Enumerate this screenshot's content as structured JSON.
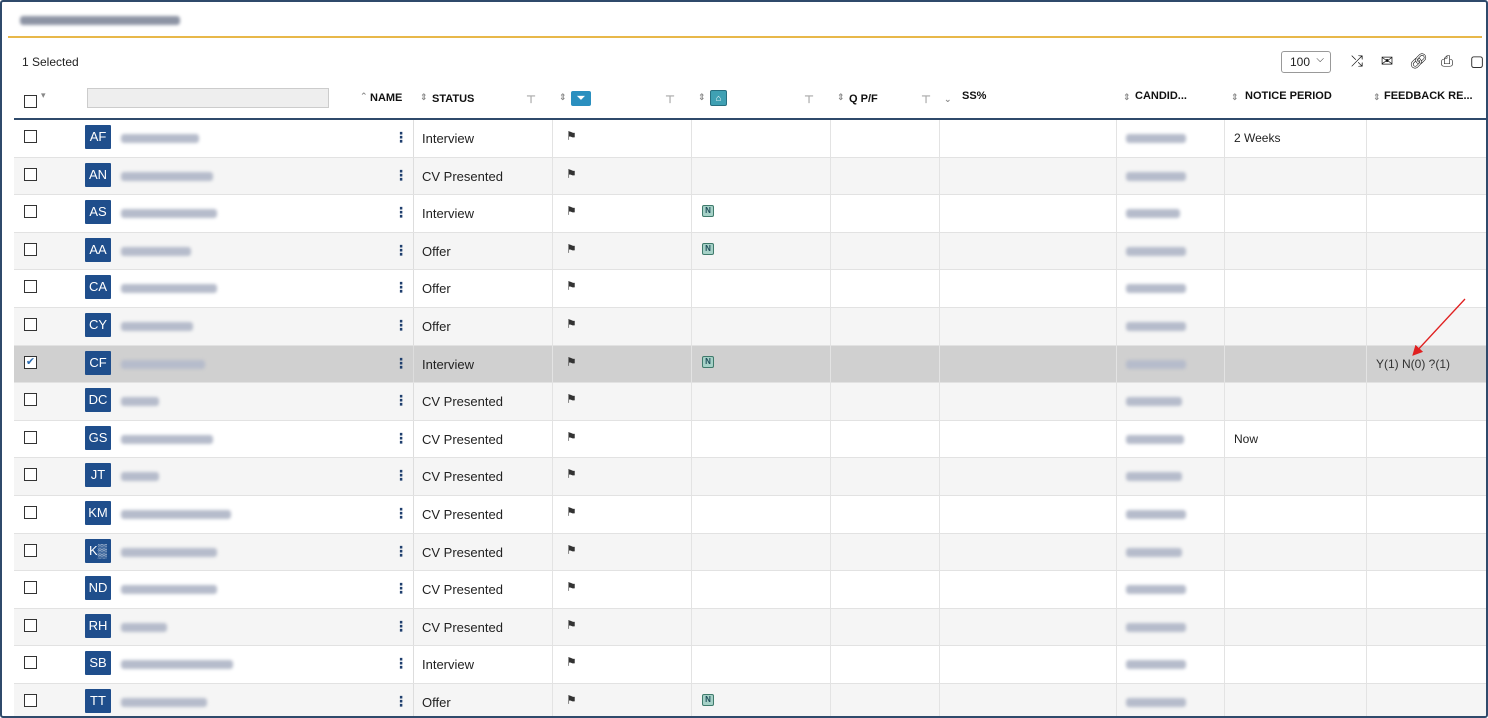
{
  "toolbar": {
    "selected_label": "1 Selected",
    "page_size": "100",
    "icons": [
      "shuffle-icon",
      "envelope-icon",
      "link-icon",
      "print-icon",
      "note-icon"
    ]
  },
  "columns": {
    "name": "NAME",
    "status": "STATUS",
    "qpf": "Q P/F",
    "ss": "SS%",
    "candid": "CANDID...",
    "notice": "NOTICE PERIOD",
    "feedback": "FEEDBACK RE..."
  },
  "rows": [
    {
      "initials": "AF",
      "status": "Interview",
      "n_badge": false,
      "notice": "2 Weeks",
      "feedback": "",
      "checked": false
    },
    {
      "initials": "AN",
      "status": "CV Presented",
      "n_badge": false,
      "notice": "",
      "feedback": "",
      "checked": false
    },
    {
      "initials": "AS",
      "status": "Interview",
      "n_badge": true,
      "notice": "",
      "feedback": "",
      "checked": false
    },
    {
      "initials": "AA",
      "status": "Offer",
      "n_badge": true,
      "notice": "",
      "feedback": "",
      "checked": false
    },
    {
      "initials": "CA",
      "status": "Offer",
      "n_badge": false,
      "notice": "",
      "feedback": "",
      "checked": false
    },
    {
      "initials": "CY",
      "status": "Offer",
      "n_badge": false,
      "notice": "",
      "feedback": "",
      "checked": false
    },
    {
      "initials": "CF",
      "status": "Interview",
      "n_badge": true,
      "notice": "",
      "feedback": "Y(1) N(0) ?(1)",
      "checked": true
    },
    {
      "initials": "DC",
      "status": "CV Presented",
      "n_badge": false,
      "notice": "",
      "feedback": "",
      "checked": false
    },
    {
      "initials": "GS",
      "status": "CV Presented",
      "n_badge": false,
      "notice": "Now",
      "feedback": "",
      "checked": false
    },
    {
      "initials": "JT",
      "status": "CV Presented",
      "n_badge": false,
      "notice": "",
      "feedback": "",
      "checked": false
    },
    {
      "initials": "KM",
      "status": "CV Presented",
      "n_badge": false,
      "notice": "",
      "feedback": "",
      "checked": false
    },
    {
      "initials": "K▒",
      "status": "CV Presented",
      "n_badge": false,
      "notice": "",
      "feedback": "",
      "checked": false
    },
    {
      "initials": "ND",
      "status": "CV Presented",
      "n_badge": false,
      "notice": "",
      "feedback": "",
      "checked": false
    },
    {
      "initials": "RH",
      "status": "CV Presented",
      "n_badge": false,
      "notice": "",
      "feedback": "",
      "checked": false
    },
    {
      "initials": "SB",
      "status": "Interview",
      "n_badge": false,
      "notice": "",
      "feedback": "",
      "checked": false
    },
    {
      "initials": "TT",
      "status": "Offer",
      "n_badge": true,
      "notice": "",
      "feedback": "",
      "checked": false
    }
  ],
  "colors": {
    "avatar": "#1f4e8c",
    "frame": "#2f4a6b",
    "title_underline": "#e8b84a",
    "selected_row": "#d0d0d0",
    "annotation_arrow": "#e02020"
  }
}
